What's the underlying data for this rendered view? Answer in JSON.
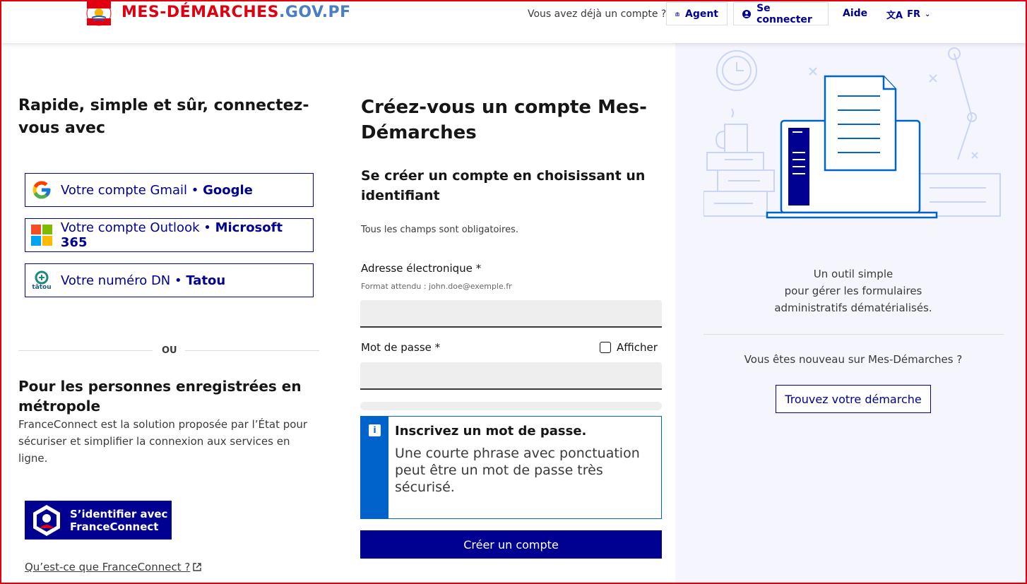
{
  "header": {
    "logo_part1": "MES-DÉMARCHES",
    "logo_part2": ".GOV.PF",
    "account_question": "Vous avez déjà un compte ?",
    "agent_label": "Agent",
    "connect_label": "Se connecter",
    "help_label": "Aide",
    "lang_label": "FR"
  },
  "left": {
    "title": "Rapide, simple et sûr, connectez-vous avec",
    "providers": [
      {
        "name": "Votre compte Gmail",
        "brand": "Google",
        "icon": "google-icon"
      },
      {
        "name": "Votre compte Outlook",
        "brand": "Microsoft 365",
        "icon": "microsoft-icon"
      },
      {
        "name": "Votre numéro DN",
        "brand": "Tatou",
        "icon": "tatou-icon",
        "icon_text": "tātou"
      }
    ],
    "separator": "OU",
    "metro_title": "Pour les personnes enregistrées en métropole",
    "metro_text": "FranceConnect est la solution proposée par l’État pour sécuriser et simplifier la connexion aux services en ligne.",
    "fc_button_line1": "S’identifier avec",
    "fc_button_line2": "FranceConnect",
    "fc_link": "Qu’est-ce que FranceConnect ?"
  },
  "form": {
    "title": "Créez-vous un compte Mes-Démarches",
    "subtitle": "Se créer un compte en choisissant un identifiant",
    "required_note": "Tous les champs sont obligatoires.",
    "email_label": "Adresse électronique",
    "email_hint": "Format attendu : john.doe@exemple.fr",
    "email_value": "",
    "password_label": "Mot de passe",
    "required_mark": "*",
    "show_label": "Afficher",
    "password_value": "",
    "notice_title": "Inscrivez un mot de passe.",
    "notice_body": "Une courte phrase avec ponctuation peut être un mot de passe très sécurisé.",
    "submit_label": "Créer un compte"
  },
  "right": {
    "description": "Un outil simple pour gérer les formulaires administratifs dématérialisés.",
    "description_lines": [
      "Un outil simple",
      "pour gérer les formulaires",
      "administratifs dématérialisés."
    ],
    "new_question": "Vous êtes nouveau sur Mes-Démarches ?",
    "find_button": "Trouvez votre démarche"
  },
  "colors": {
    "primary_blue": "#000091",
    "info_blue": "#0063cb",
    "brand_red": "#e1000f",
    "panel_bg": "#f5f5fe"
  }
}
